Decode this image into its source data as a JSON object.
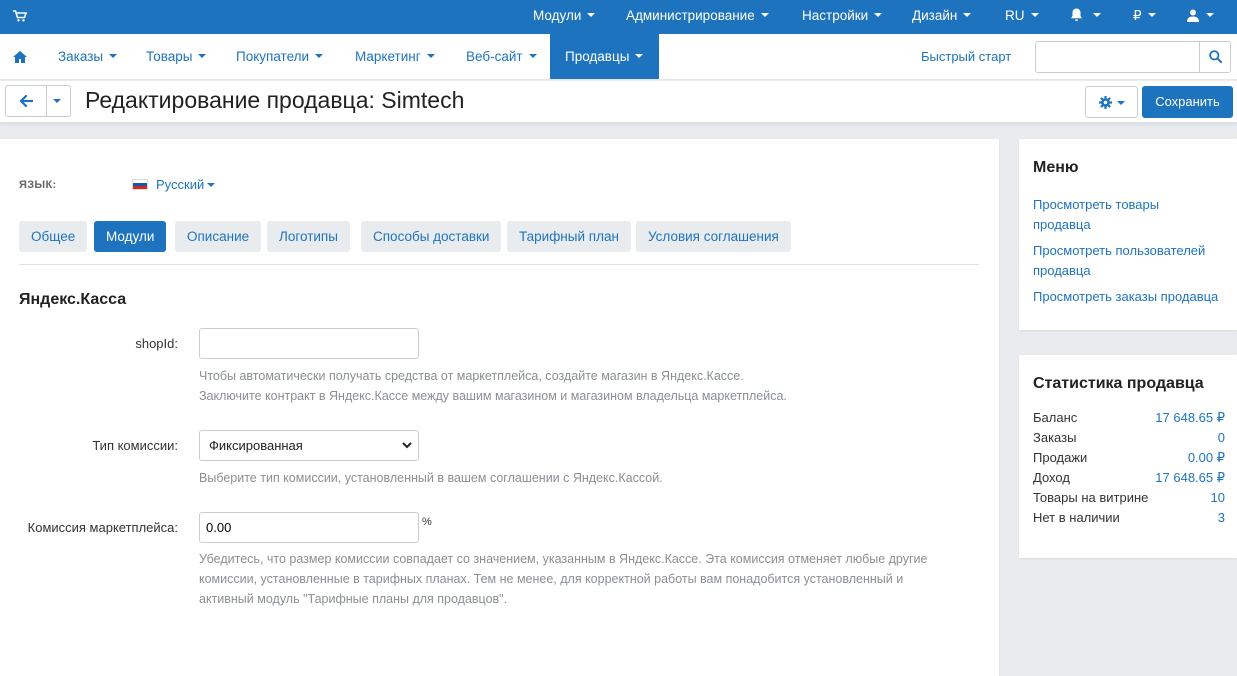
{
  "topbar": {
    "cart_icon": "cart-icon",
    "items": [
      {
        "label": "Модули"
      },
      {
        "label": "Администрирование"
      },
      {
        "label": "Настройки"
      },
      {
        "label": "Дизайн"
      },
      {
        "label": "RU"
      },
      {
        "label": ""
      },
      {
        "label": "₽"
      },
      {
        "label": ""
      }
    ],
    "bell_icon": "bell-icon",
    "user_icon": "user-icon"
  },
  "navbar": {
    "home_icon": "home-icon",
    "items": [
      {
        "label": "Заказы"
      },
      {
        "label": "Товары"
      },
      {
        "label": "Покупатели"
      },
      {
        "label": "Маркетинг"
      },
      {
        "label": "Веб-сайт"
      },
      {
        "label": "Продавцы"
      }
    ],
    "active_index": 5,
    "quick_start": "Быстрый старт",
    "search": {
      "value": "",
      "placeholder": ""
    },
    "search_icon": "search-icon"
  },
  "header": {
    "title": "Редактирование продавца: Simtech",
    "save_label": "Сохранить",
    "gear_icon": "gear-icon",
    "back_icon": "arrow-left-icon"
  },
  "main": {
    "language_label": "ЯЗЫК:",
    "language_value": "Русский",
    "tabs": [
      {
        "label": "Общее"
      },
      {
        "label": "Модули"
      },
      {
        "label": "Описание"
      },
      {
        "label": "Логотипы"
      },
      {
        "label": "Способы доставки"
      },
      {
        "label": "Тарифный план"
      },
      {
        "label": "Условия соглашения"
      }
    ],
    "active_tab": 1,
    "section_title": "Яндекс.Касса",
    "fields": {
      "shop_id": {
        "label": "shopId:",
        "value": "",
        "hint_lines": [
          "Чтобы автоматически получать средства от маркетплейса, создайте магазин в Яндекс.Кассе.",
          "Заключите контракт в Яндекс.Кассе между вашим магазином и магазином владельца маркетплейса."
        ]
      },
      "commission_type": {
        "label": "Тип комиссии:",
        "value": "Фиксированная",
        "hint_lines": [
          "Выберите тип комиссии, установленный в вашем соглашении с Яндекс.Кассой."
        ]
      },
      "marketplace_commission": {
        "label": "Комиссия маркетплейса:",
        "value": "0.00",
        "unit": "%",
        "hint_lines": [
          "Убедитесь, что размер комиссии совпадает со значением, указанным в Яндекс.Кассе. Эта комиссия отменяет любые другие",
          "комиссии, установленные в тарифных планах. Тем не менее, для корректной работы вам понадобится установленный и",
          "активный модуль \"Тарифные планы для продавцов\"."
        ]
      }
    }
  },
  "sidebar": {
    "menu_title": "Меню",
    "menu_links": [
      {
        "line1": "Просмотреть товары",
        "line2": "продавца"
      },
      {
        "line1": "Просмотреть пользователей",
        "line2": "продавца"
      },
      {
        "line1": "Просмотреть заказы продавца",
        "line2": ""
      }
    ],
    "stats_title": "Статистика продавца",
    "stats": [
      {
        "label": "Баланс",
        "value": "17 648.65 ₽"
      },
      {
        "label": "Заказы",
        "value": "0"
      },
      {
        "label": "Продажи",
        "value": "0.00 ₽"
      },
      {
        "label": "Доход",
        "value": "17 648.65 ₽"
      },
      {
        "label": "Товары на витрине",
        "value": "10"
      },
      {
        "label": "Нет в наличии",
        "value": "3"
      }
    ]
  },
  "colors": {
    "accent": "#1e73be",
    "background": "#e9ecef"
  }
}
